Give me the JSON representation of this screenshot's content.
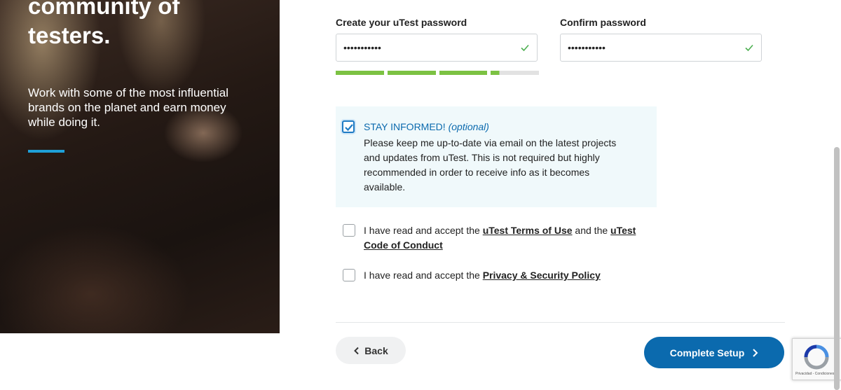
{
  "hero": {
    "heading": "community of\ntesters.",
    "description": "Work with some of the most influential brands on the planet and earn money while doing it."
  },
  "password": {
    "label": "Create your uTest password",
    "value": "•••••••••••",
    "strength_fraction": 0.79
  },
  "confirm_password": {
    "label": "Confirm password",
    "value": "•••••••••••"
  },
  "stay_informed": {
    "checked": true,
    "title": "STAY INFORMED!",
    "optional": "(optional)",
    "description": "Please keep me up-to-date via email on the latest projects and updates from uTest. This is not required but highly recommended in order to receive info as it becomes available."
  },
  "terms": {
    "checked": false,
    "prefix": "I have read and accept the ",
    "terms_link": "uTest Terms of Use",
    "middle": " and the ",
    "code_link": "uTest Code of Conduct"
  },
  "privacy": {
    "checked": false,
    "prefix": "I have read and accept the ",
    "link": "Privacy & Security Policy"
  },
  "buttons": {
    "back": "Back",
    "complete": "Complete Setup"
  },
  "recaptcha": {
    "text": "Privacidad - Condiciones"
  },
  "colors": {
    "primary": "#0b6aae",
    "strength": "#7cc243",
    "accent_rule": "#1ea0d8",
    "informed_bg": "#f0f9fb"
  }
}
